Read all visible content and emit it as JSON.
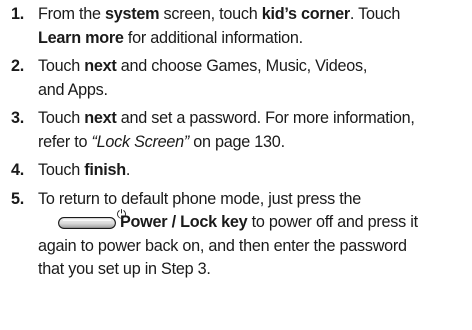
{
  "steps": [
    {
      "number": "1.",
      "parts": [
        "From the ",
        "system",
        " screen, touch ",
        "kid’s corner",
        ". Touch ",
        "Learn more",
        " for additional information."
      ]
    },
    {
      "number": "2.",
      "parts": [
        "Touch ",
        "next",
        " and choose Games, Music, Videos,",
        "and Apps."
      ]
    },
    {
      "number": "3.",
      "parts": [
        "Touch ",
        "next",
        " and set a password. For more information,",
        "refer to ",
        "“Lock Screen”",
        " on page 130."
      ]
    },
    {
      "number": "4.",
      "parts": [
        "Touch ",
        "finish",
        "."
      ]
    },
    {
      "number": "5.",
      "parts": [
        "To return to default phone mode, just press the",
        "Power / Lock key",
        " to power off and press it",
        "again to power back on, and then enter the password",
        "that you set up in Step 3."
      ]
    }
  ],
  "icons": {
    "power_key": "power-key-icon",
    "power_symbol": "⏻"
  }
}
